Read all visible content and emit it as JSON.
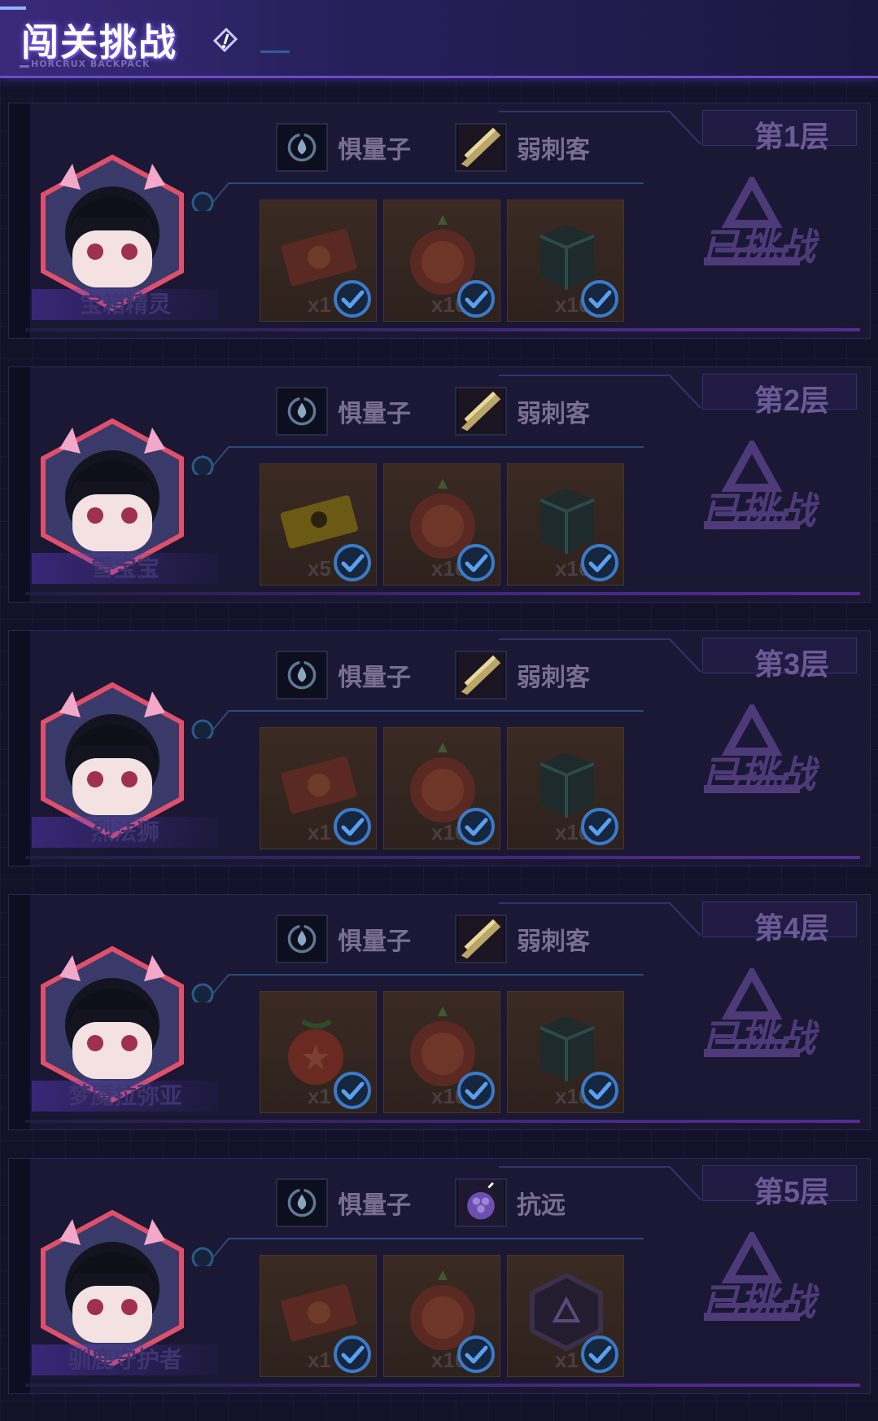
{
  "header": {
    "title": "闯关挑战",
    "subtitle": "HORCRUX BACKPACK"
  },
  "stages": [
    {
      "floor": "第1层",
      "boss_name": "宝箱精灵",
      "status": "已挑战",
      "tags": [
        {
          "icon": "quantum-icon",
          "label": "惧量子"
        },
        {
          "icon": "blade-icon",
          "label": "弱刺客"
        }
      ],
      "rewards": [
        {
          "icon": "ticket-icon",
          "qty": "x1",
          "claimed": true
        },
        {
          "icon": "ornament-icon",
          "qty": "x100",
          "claimed": true
        },
        {
          "icon": "cube-icon",
          "qty": "x100",
          "claimed": true
        }
      ]
    },
    {
      "floor": "第2层",
      "boss_name": "雪宝宝",
      "status": "已挑战",
      "tags": [
        {
          "icon": "quantum-icon",
          "label": "惧量子"
        },
        {
          "icon": "blade-icon",
          "label": "弱刺客"
        }
      ],
      "rewards": [
        {
          "icon": "gold-card-icon",
          "qty": "x5",
          "claimed": true
        },
        {
          "icon": "ornament-icon",
          "qty": "x100",
          "claimed": true
        },
        {
          "icon": "cube-icon",
          "qty": "x100",
          "claimed": true
        }
      ]
    },
    {
      "floor": "第3层",
      "boss_name": "烈法狮",
      "status": "已挑战",
      "tags": [
        {
          "icon": "quantum-icon",
          "label": "惧量子"
        },
        {
          "icon": "blade-icon",
          "label": "弱刺客"
        }
      ],
      "rewards": [
        {
          "icon": "ticket-icon",
          "qty": "x1",
          "claimed": true
        },
        {
          "icon": "ornament-icon",
          "qty": "x100",
          "claimed": true
        },
        {
          "icon": "cube-icon",
          "qty": "x100",
          "claimed": true
        }
      ]
    },
    {
      "floor": "第4层",
      "boss_name": "梦魇拉弥亚",
      "status": "已挑战",
      "tags": [
        {
          "icon": "quantum-icon",
          "label": "惧量子"
        },
        {
          "icon": "blade-icon",
          "label": "弱刺客"
        }
      ],
      "rewards": [
        {
          "icon": "bauble-icon",
          "qty": "x1",
          "claimed": true
        },
        {
          "icon": "ornament-icon",
          "qty": "x100",
          "claimed": true
        },
        {
          "icon": "cube-icon",
          "qty": "x100",
          "claimed": true
        }
      ]
    },
    {
      "floor": "第5层",
      "boss_name": "驯鹿守护者",
      "status": "已挑战",
      "tags": [
        {
          "icon": "quantum-icon",
          "label": "惧量子"
        },
        {
          "icon": "grape-icon",
          "label": "抗远"
        }
      ],
      "rewards": [
        {
          "icon": "ticket-icon",
          "qty": "x1",
          "claimed": true
        },
        {
          "icon": "ornament-icon",
          "qty": "x100",
          "claimed": true
        },
        {
          "icon": "hex-emblem-icon",
          "qty": "x1",
          "claimed": true
        }
      ]
    }
  ]
}
